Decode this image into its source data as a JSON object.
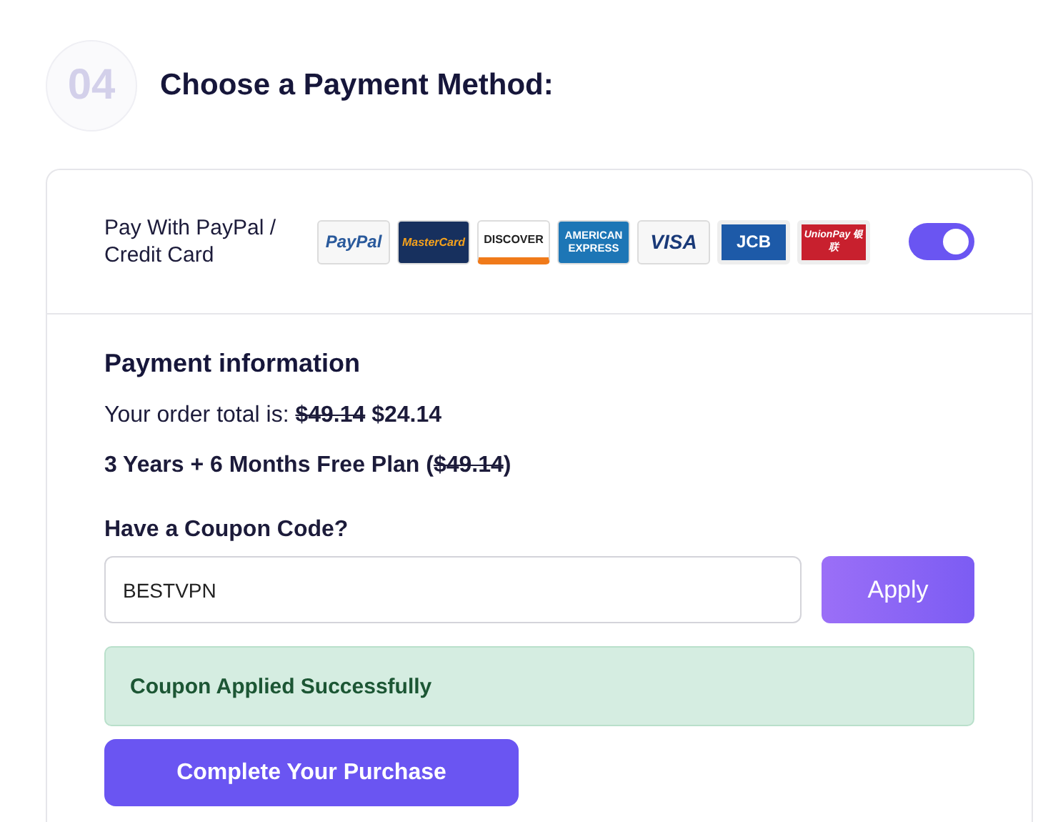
{
  "step": {
    "number": "04",
    "title": "Choose a Payment Method:"
  },
  "payment_method": {
    "label": "Pay With PayPal / Credit Card",
    "enabled": true,
    "cards": [
      {
        "kind": "paypal",
        "text": "PayPal"
      },
      {
        "kind": "mastercard",
        "text": "MasterCard"
      },
      {
        "kind": "discover",
        "text": "DISCOVER"
      },
      {
        "kind": "amex",
        "text": "AMERICAN EXPRESS"
      },
      {
        "kind": "visa",
        "text": "VISA"
      },
      {
        "kind": "jcb",
        "text": "JCB"
      },
      {
        "kind": "unionpay",
        "text": "UnionPay 银联"
      }
    ]
  },
  "payment_info": {
    "heading": "Payment information",
    "total": [
      {
        "text": "Your order total is: ",
        "bold": false,
        "struck": false
      },
      {
        "text": "$49.14",
        "bold": true,
        "struck": true
      },
      {
        "text": " $24.14",
        "bold": true,
        "struck": false
      }
    ],
    "plan": [
      {
        "text": "3 Years + 6 Months Free Plan (",
        "bold": true,
        "struck": false
      },
      {
        "text": "$49.14",
        "bold": true,
        "struck": true
      },
      {
        "text": ")",
        "bold": true,
        "struck": false
      }
    ],
    "coupon_label": "Have a Coupon Code?",
    "coupon_value": "BESTVPN",
    "apply_button": "Apply",
    "alert": {
      "kind": "success",
      "text": "Coupon Applied Successfully"
    },
    "submit_button": "Complete Your Purchase"
  }
}
